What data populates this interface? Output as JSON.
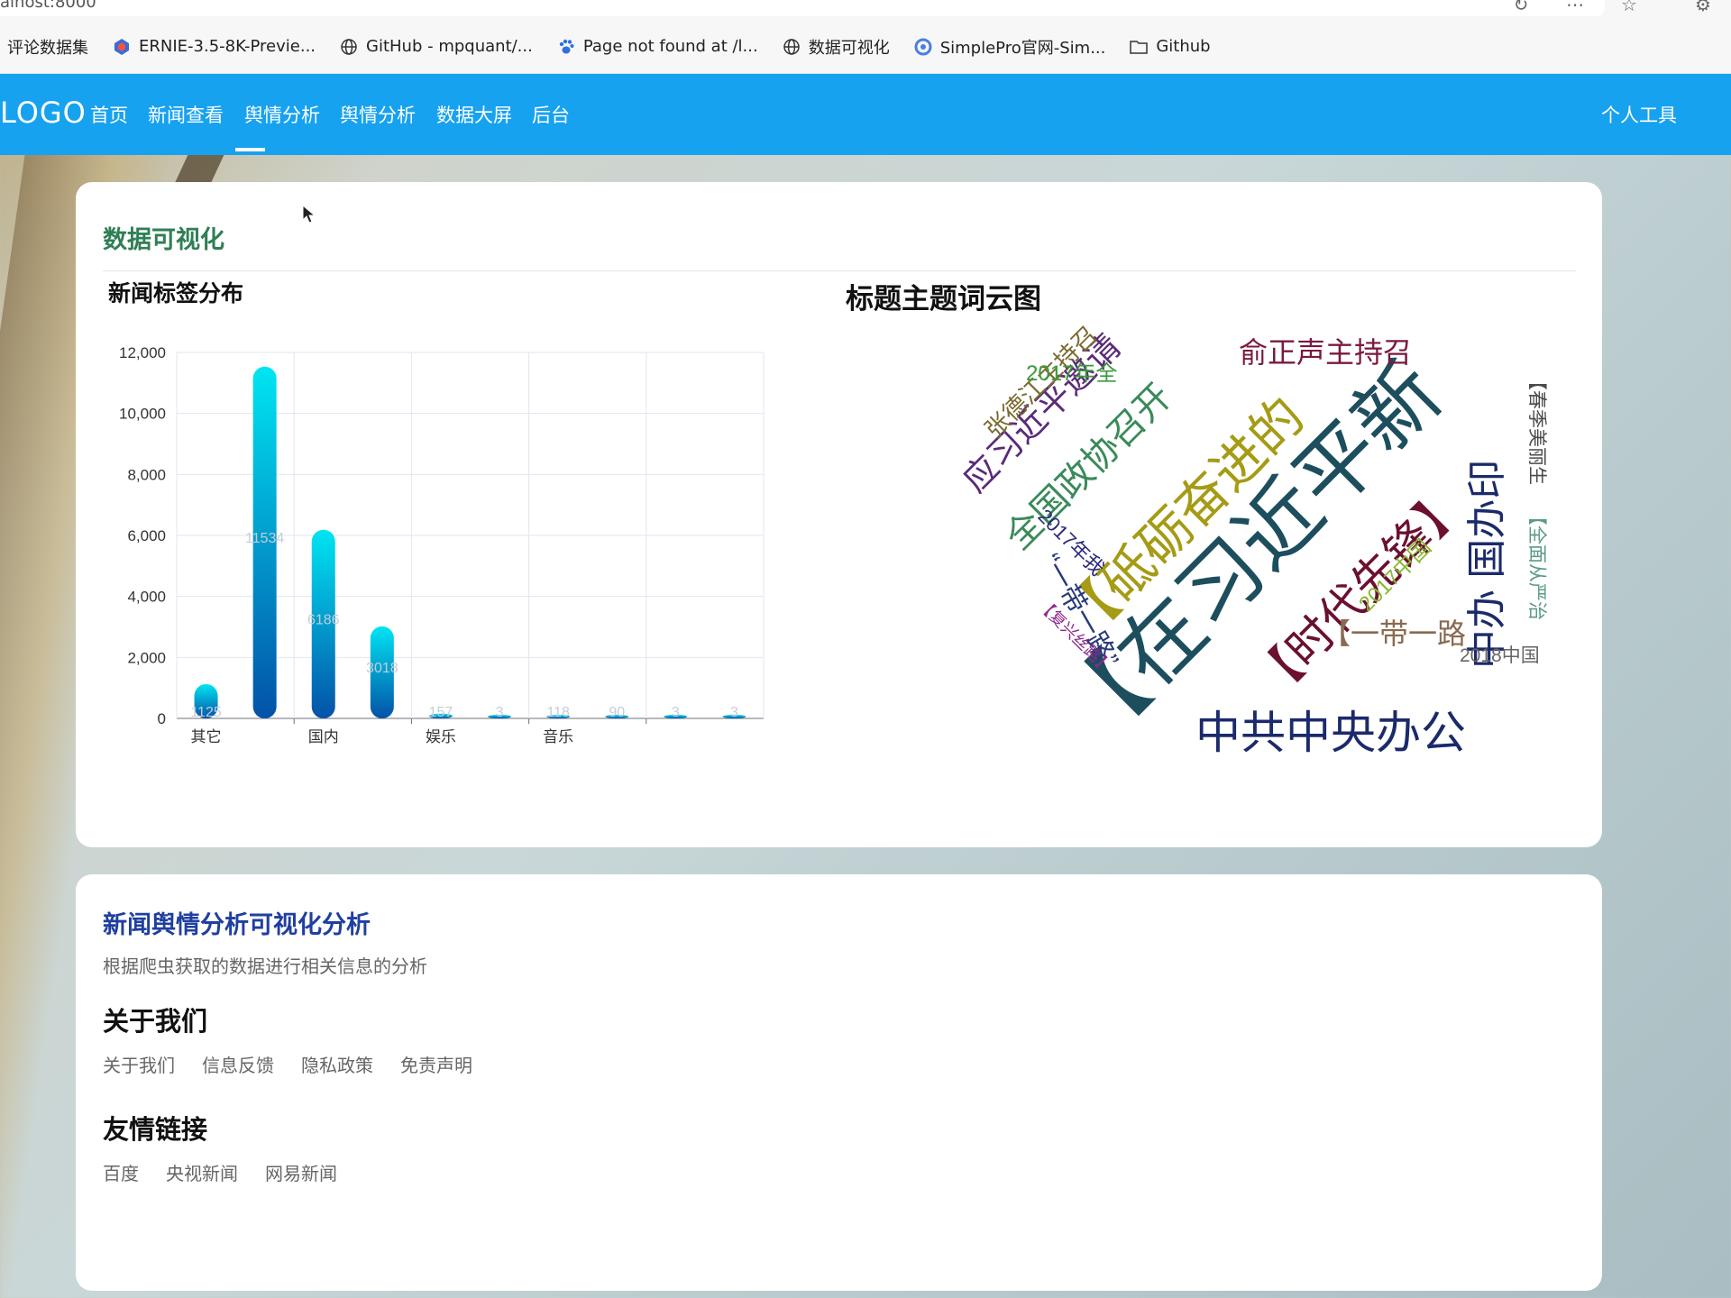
{
  "browser": {
    "address_partial": "alhost:8000",
    "bookmarks": [
      {
        "label": "评论数据集",
        "icon": "none"
      },
      {
        "label": "ERNIE-3.5-8K-Previe...",
        "icon": "ernie-icon"
      },
      {
        "label": "GitHub - mpquant/...",
        "icon": "globe-icon"
      },
      {
        "label": "Page not found at /l...",
        "icon": "paw-icon"
      },
      {
        "label": "数据可视化",
        "icon": "globe-icon"
      },
      {
        "label": "SimplePro官网-Sim...",
        "icon": "simplepro-icon"
      },
      {
        "label": "Github",
        "icon": "folder-icon"
      }
    ]
  },
  "nav": {
    "logo": "LOGO",
    "items": [
      "首页",
      "新闻查看",
      "舆情分析",
      "舆情分析",
      "数据大屏",
      "后台"
    ],
    "active_index": 2,
    "right": "个人工具",
    "color": "#17a2f0"
  },
  "viz": {
    "title": "数据可视化",
    "bar_chart_title": "新闻标签分布",
    "wordcloud_title": "标题主题词云图"
  },
  "chart_data": {
    "type": "bar",
    "categories": [
      "其它",
      "",
      "国内",
      "",
      "娱乐",
      "",
      "音乐",
      "",
      "",
      ""
    ],
    "tick_labels": [
      "其它",
      "国内",
      "娱乐",
      "音乐"
    ],
    "values": [
      1125,
      11534,
      6186,
      3018,
      157,
      3,
      118,
      90,
      3,
      3
    ],
    "data_labels": [
      "1125",
      "11534",
      "6186",
      "3018",
      "157",
      "3",
      "118",
      "90",
      "3",
      "3"
    ],
    "yticks": [
      "0",
      "2,000",
      "4,000",
      "6,000",
      "8,000",
      "10,000",
      "12,000"
    ],
    "ylim": [
      0,
      12000
    ],
    "grid": true
  },
  "wordcloud": {
    "words": [
      {
        "text": "【在习近平新",
        "color": "#1d4e5e"
      },
      {
        "text": "【砥砺奋进的",
        "color": "#a59b15"
      },
      {
        "text": "【时代先锋】",
        "color": "#6b1030"
      },
      {
        "text": "中共中央办公",
        "color": "#1b2a6b"
      },
      {
        "text": "中办 国办印",
        "color": "#1b2a6b"
      },
      {
        "text": "应习近平邀请",
        "color": "#5a2a7a"
      },
      {
        "text": "全国政协召开",
        "color": "#3a8a5a"
      },
      {
        "text": "俞正声主持召",
        "color": "#7a1840"
      },
      {
        "text": "张德江主持召",
        "color": "#7a6a30"
      },
      {
        "text": "2017年全",
        "color": "#3a9a3a"
      },
      {
        "text": "【一带一路",
        "color": "#8a6a50"
      },
      {
        "text": "2018中国",
        "color": "#666666"
      },
      {
        "text": "2017中国",
        "color": "#8ab830"
      },
      {
        "text": "2017年我",
        "color": "#2a2a7a"
      },
      {
        "text": "“一带一路”",
        "color": "#2a3a7a"
      },
      {
        "text": "【复兴丝路】",
        "color": "#8a2a8a"
      },
      {
        "text": "【春季美丽生",
        "color": "#4a4a4a"
      },
      {
        "text": "【全面从严治",
        "color": "#5a9a8a"
      }
    ]
  },
  "footer": {
    "analysis_title": "新闻舆情分析可视化分析",
    "analysis_desc": "根据爬虫获取的数据进行相关信息的分析",
    "about_title": "关于我们",
    "about_links": [
      "关于我们",
      "信息反馈",
      "隐私政策",
      "免责声明"
    ],
    "friend_title": "友情链接",
    "friend_links": [
      "百度",
      "央视新闻",
      "网易新闻"
    ]
  }
}
